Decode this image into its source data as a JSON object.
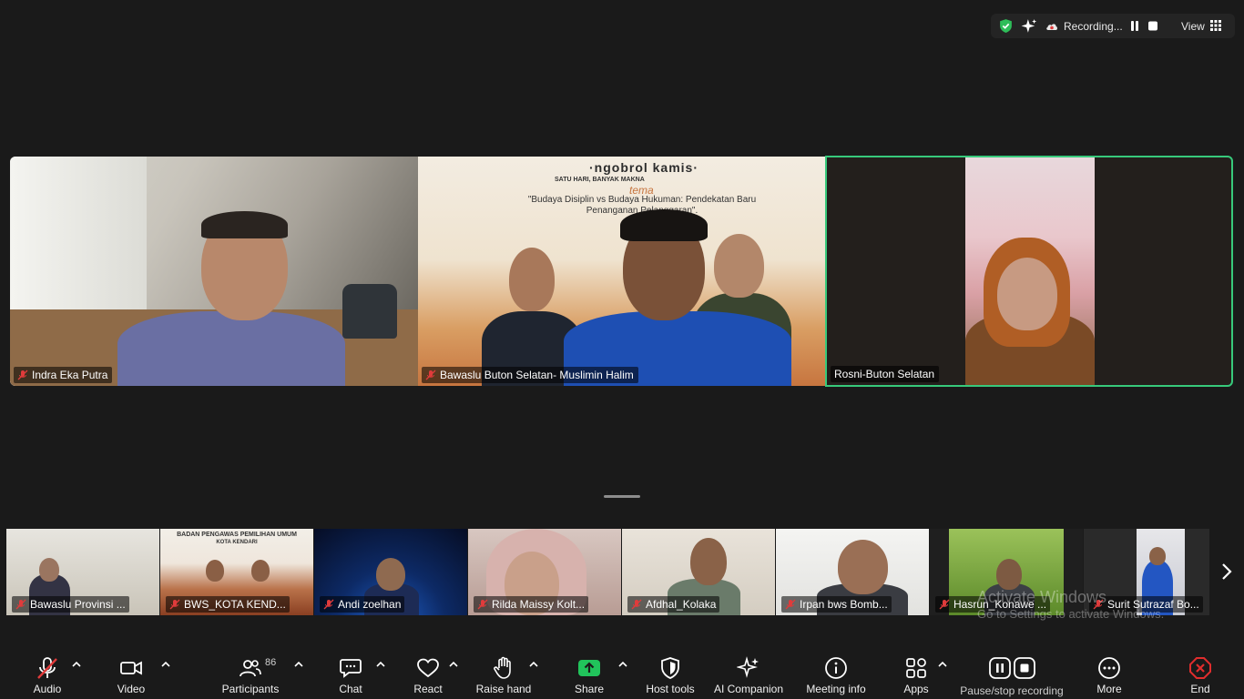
{
  "status_bar": {
    "recording_text": "Recording...",
    "view_label": "View"
  },
  "main_tiles": [
    {
      "name": "Indra Eka Putra"
    },
    {
      "name": "Bawaslu Buton Selatan- Muslimin Halim"
    },
    {
      "name": "Rosni-Buton Selatan"
    }
  ],
  "poster": {
    "title": "·ngobrol kamis·",
    "subtitle": "SATU HARI, BANYAK MAKNA",
    "theme": "tema",
    "text": "\"Budaya Disiplin vs Budaya Hukuman: Pendekatan Baru Penanganan Pelanggaran\"."
  },
  "thumbnails": [
    {
      "name": "Bawaslu Provinsi ..."
    },
    {
      "name": "BWS_KOTA KEND...",
      "banner": "BADAN PENGAWAS PEMILIHAN UMUM",
      "banner_sub": "KOTA KENDARI"
    },
    {
      "name": "Andi zoelhan"
    },
    {
      "name": "Rilda Maissy Kolt..."
    },
    {
      "name": "Afdhal_Kolaka"
    },
    {
      "name": "Irpan bws Bomb..."
    },
    {
      "name": "Hasrun_Konawe ..."
    },
    {
      "name": "Surit Sutrazaf Bo..."
    }
  ],
  "watermark": {
    "line1": "Activate Windows",
    "line2": "Go to Settings to activate Windows."
  },
  "toolbar": {
    "audio": "Audio",
    "video": "Video",
    "participants": "Participants",
    "participants_count": "86",
    "chat": "Chat",
    "react": "React",
    "raise_hand": "Raise hand",
    "share": "Share",
    "host_tools": "Host tools",
    "ai_companion": "AI Companion",
    "meeting_info": "Meeting info",
    "apps": "Apps",
    "pause_stop_recording": "Pause/stop recording",
    "more": "More",
    "end": "End"
  },
  "colors": {
    "active_speaker_border": "#37c97b",
    "share_green": "#21c35b",
    "end_red": "#e02d2d",
    "muted_red": "#e03b3b",
    "background": "#1a1a1a"
  }
}
